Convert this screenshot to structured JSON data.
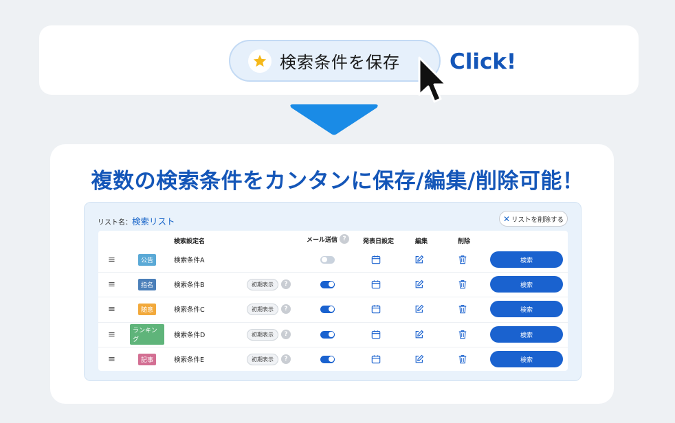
{
  "hero": {
    "save_button_label": "検索条件を保存",
    "click_label": "Click!"
  },
  "headline": "複数の検索条件をカンタンに保存/編集/削除可能！",
  "panel": {
    "list_name_label": "リスト名：",
    "list_name_value": "検索リスト",
    "delete_list_label": "リストを削除する",
    "columns": {
      "name": "検索設定名",
      "mail": "メール送信",
      "publish": "発表日設定",
      "edit": "編集",
      "delete": "削除"
    },
    "rows": [
      {
        "tag": "公告",
        "tag_color": "#5aa9d6",
        "name": "検索条件A",
        "initial": "",
        "toggle_on": false,
        "search_label": "検索"
      },
      {
        "tag": "指名",
        "tag_color": "#4b7fb9",
        "name": "検索条件B",
        "initial": "初期表示",
        "toggle_on": true,
        "search_label": "検索"
      },
      {
        "tag": "随意",
        "tag_color": "#f2a93b",
        "name": "検索条件C",
        "initial": "初期表示",
        "toggle_on": true,
        "search_label": "検索"
      },
      {
        "tag": "ランキング",
        "tag_color": "#5fb47a",
        "name": "検索条件D",
        "initial": "初期表示",
        "toggle_on": true,
        "search_label": "検索"
      },
      {
        "tag": "記事",
        "tag_color": "#d36f93",
        "name": "検索条件E",
        "initial": "初期表示",
        "toggle_on": true,
        "search_label": "検索"
      }
    ]
  },
  "colors": {
    "accent": "#1456b8",
    "button_blue": "#1a62cf",
    "toggle_on": "#1a62cf",
    "toggle_off": "#c9d2dd"
  }
}
